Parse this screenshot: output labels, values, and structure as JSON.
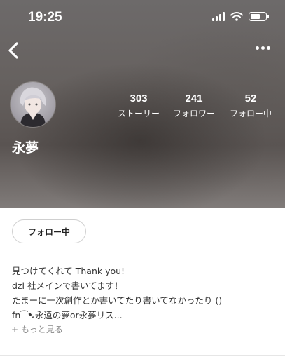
{
  "status_bar": {
    "time": "19:25",
    "battery_level": 0.7
  },
  "profile": {
    "name": "永夢",
    "stats": [
      {
        "value": "303",
        "label": "ストーリー"
      },
      {
        "value": "241",
        "label": "フォロワー"
      },
      {
        "value": "52",
        "label": "フォロー中"
      }
    ]
  },
  "actions": {
    "follow_label": "フォロー中"
  },
  "bio": {
    "lines": [
      "見つけてくれて Thank you!",
      "dzl 社メインで書いてます！",
      "たまーに一次創作とか書いてたり書いてなかったり ()",
      "fn⁀➷永遠の夢or永夢リス..."
    ],
    "more_label": "+ もっと見る"
  },
  "colors": {
    "header_bg": "#6b6766",
    "text": "#333333",
    "muted": "#8a8a8a"
  },
  "icons": [
    "back-chevron-icon",
    "more-dots-icon",
    "signal-icon",
    "wifi-icon",
    "battery-icon"
  ]
}
